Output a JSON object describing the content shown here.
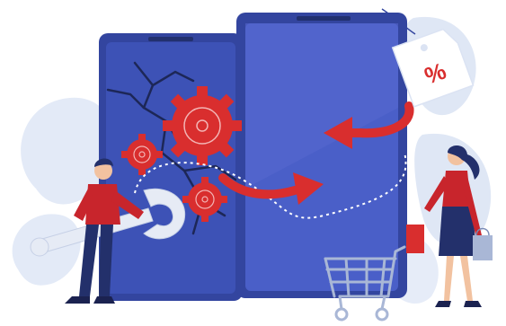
{
  "illustration": {
    "price_tag": {
      "text": "%"
    },
    "icons": [
      "gear-icon",
      "wrench-icon",
      "shopping-cart-icon",
      "price-tag-icon",
      "arrow-icon",
      "leaf-icon"
    ],
    "colors": {
      "background_blob": "#dfe7f5",
      "phone_body": "#3a4eb0",
      "phone_screen": "#4a5fc8",
      "phone_screen_light": "#5a6fd4",
      "accent_red": "#d92e2e",
      "cable_dash": "#ffffff",
      "leaf": "#c9d8f0",
      "figure_shirt": "#c8252c",
      "figure_pants": "#23306b",
      "wrench": "#e6ebf5",
      "cart": "#a9b7d6"
    }
  }
}
